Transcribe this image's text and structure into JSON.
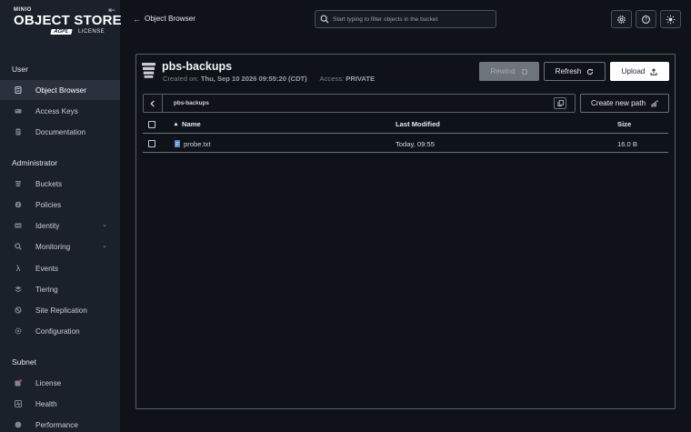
{
  "brand": {
    "minio": "MINIO",
    "object_store": "OBJECT STORE",
    "agpl": "AGPL",
    "license": "LICENSE"
  },
  "sidebar": {
    "sections": [
      {
        "title": "User",
        "items": [
          {
            "label": "Object Browser",
            "icon": "object-browser-icon",
            "active": true
          },
          {
            "label": "Access Keys",
            "icon": "access-keys-icon"
          },
          {
            "label": "Documentation",
            "icon": "documentation-icon"
          }
        ]
      },
      {
        "title": "Administrator",
        "items": [
          {
            "label": "Buckets",
            "icon": "buckets-icon"
          },
          {
            "label": "Policies",
            "icon": "policies-icon"
          },
          {
            "label": "Identity",
            "icon": "identity-icon",
            "expandable": true
          },
          {
            "label": "Monitoring",
            "icon": "monitoring-icon",
            "expandable": true
          },
          {
            "label": "Events",
            "icon": "lambda-icon"
          },
          {
            "label": "Tiering",
            "icon": "tiering-icon"
          },
          {
            "label": "Site Replication",
            "icon": "site-replication-icon"
          },
          {
            "label": "Configuration",
            "icon": "gear-icon"
          }
        ]
      },
      {
        "title": "Subnet",
        "items": [
          {
            "label": "License",
            "icon": "license-icon"
          },
          {
            "label": "Health",
            "icon": "health-icon"
          },
          {
            "label": "Performance",
            "icon": "performance-icon"
          }
        ]
      }
    ]
  },
  "header": {
    "title": "Object Browser",
    "search_placeholder": "Start typing to filter objects in the bucket",
    "buttons": [
      "settings-icon",
      "help-icon",
      "theme-toggle-icon"
    ]
  },
  "bucket": {
    "name": "pbs-backups",
    "created_label": "Created on:",
    "created_value": "Thu, Sep 10 2026 09:55:20 (CDT)",
    "access_label": "Access:",
    "access_value": "PRIVATE"
  },
  "actions": {
    "rewind": "Rewind",
    "refresh": "Refresh",
    "upload": "Upload",
    "create_new_path": "Create new path"
  },
  "path": {
    "current": "pbs-backups"
  },
  "table": {
    "columns": {
      "name": "Name",
      "last_modified": "Last Modified",
      "size": "Size"
    },
    "rows": [
      {
        "name": "probe.txt",
        "last_modified": "Today, 09:55",
        "size": "16.0 B"
      }
    ]
  },
  "colors": {
    "sidebar_bg": "#1b212b",
    "page_bg": "#0f1218",
    "active_item_bg": "#2a313c",
    "license_badge": "#c72c48"
  }
}
